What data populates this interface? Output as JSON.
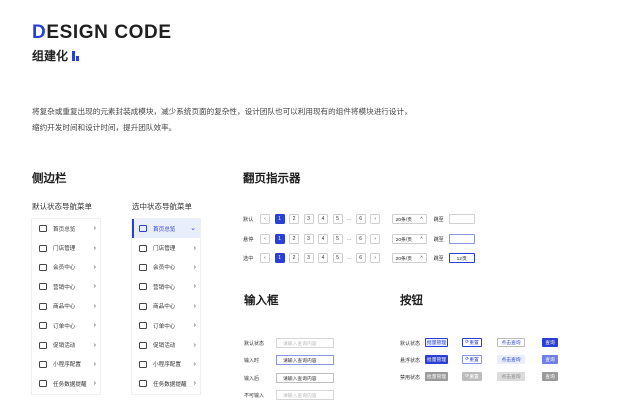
{
  "header": {
    "title_first": "D",
    "title_rest": "ESIGN CODE",
    "subtitle": "组建化",
    "description": "将复杂或重复出现的元素封装成模块，减少系统页面的复杂性，设计团队也可以利用现有的组件将模块进行设计，缩约开发时间和设计时间，提升团队效率。"
  },
  "sidebar_section": {
    "heading": "侧边栏",
    "default_label": "默认状态导航菜单",
    "selected_label": "选中状态导航菜单",
    "items": [
      {
        "label": "首页总览",
        "icon": "store-icon"
      },
      {
        "label": "门店管理",
        "icon": "shop-icon"
      },
      {
        "label": "会员中心",
        "icon": "heart-icon"
      },
      {
        "label": "营销中心",
        "icon": "bar-chart-icon"
      },
      {
        "label": "商品中心",
        "icon": "box-icon"
      },
      {
        "label": "订单中心",
        "icon": "document-icon"
      },
      {
        "label": "促销活动",
        "icon": "tag-icon"
      },
      {
        "label": "小程序配置",
        "icon": "shield-icon"
      },
      {
        "label": "任务数据提醒",
        "icon": "tasks-icon"
      }
    ]
  },
  "pagination_section": {
    "heading": "翻页指示器",
    "rows": [
      {
        "label": "默认",
        "input_state": "default",
        "input_value": ""
      },
      {
        "label": "悬停",
        "input_state": "hover",
        "input_value": ""
      },
      {
        "label": "选中",
        "input_state": "focus",
        "input_value": "12页"
      }
    ],
    "pages": [
      "1",
      "2",
      "3",
      "4",
      "5"
    ],
    "dots": "...",
    "last_page": "6",
    "prev": "‹",
    "next": "›",
    "page_size": "20条/页",
    "jump_label": "跳至"
  },
  "input_section": {
    "heading": "输入框",
    "rows": [
      {
        "label": "默认状态",
        "text": "请输入查询内容"
      },
      {
        "label": "输入时",
        "text": "请输入查询内容"
      },
      {
        "label": "输入后",
        "text": "请输入查询内容"
      },
      {
        "label": "不可输入",
        "text": "请输入查询内容"
      }
    ]
  },
  "button_section": {
    "heading": "按钮",
    "rows": [
      {
        "label": "默认状态",
        "batch": "批量管理",
        "reset": "重置",
        "search_query": "点击查询",
        "query": "查询"
      },
      {
        "label": "悬浮状态",
        "batch": "批量管理",
        "reset": "重置",
        "search_query": "点击查询",
        "query": "查询"
      },
      {
        "label": "禁用状态",
        "batch": "批量管理",
        "reset": "重置",
        "search_query": "点击查询",
        "query": "查询"
      }
    ]
  },
  "colors": {
    "primary": "#2a3fd6",
    "primary_light": "#e9eefc"
  }
}
